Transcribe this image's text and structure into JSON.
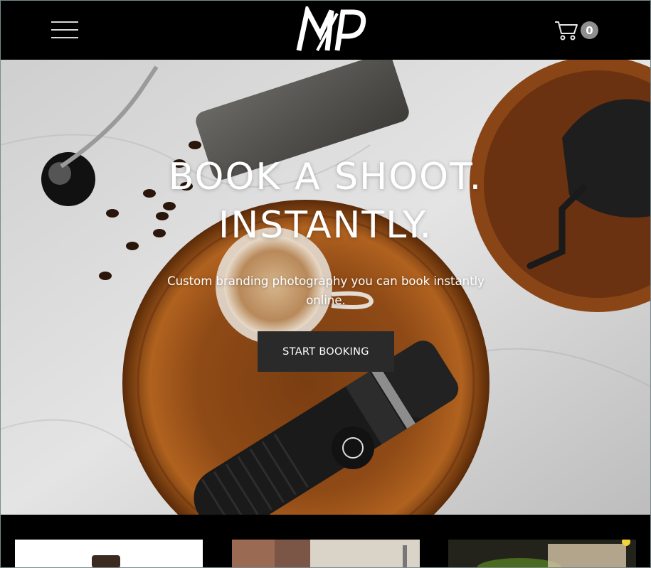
{
  "header": {
    "menu_icon": "hamburger-menu-icon",
    "logo_text": "MP",
    "cart_icon": "shopping-cart-icon",
    "cart_count": "0"
  },
  "hero": {
    "title_line1": "BOOK A SHOOT.",
    "title_line2": "INSTANTLY.",
    "subtitle": "Custom branding photography you can book instantly online.",
    "cta_label": "START BOOKING",
    "background_image": "coffee-flatlay-photo"
  },
  "gallery": {
    "cards": [
      {
        "image": "coffee-grinder-photo"
      },
      {
        "image": "barista-pouring-photo"
      },
      {
        "image": "food-plate-photo"
      }
    ]
  },
  "colors": {
    "header_bg": "#000000",
    "cta_bg": "#2a2a2a",
    "cart_badge": "#8f8f8f",
    "text": "#ffffff"
  }
}
